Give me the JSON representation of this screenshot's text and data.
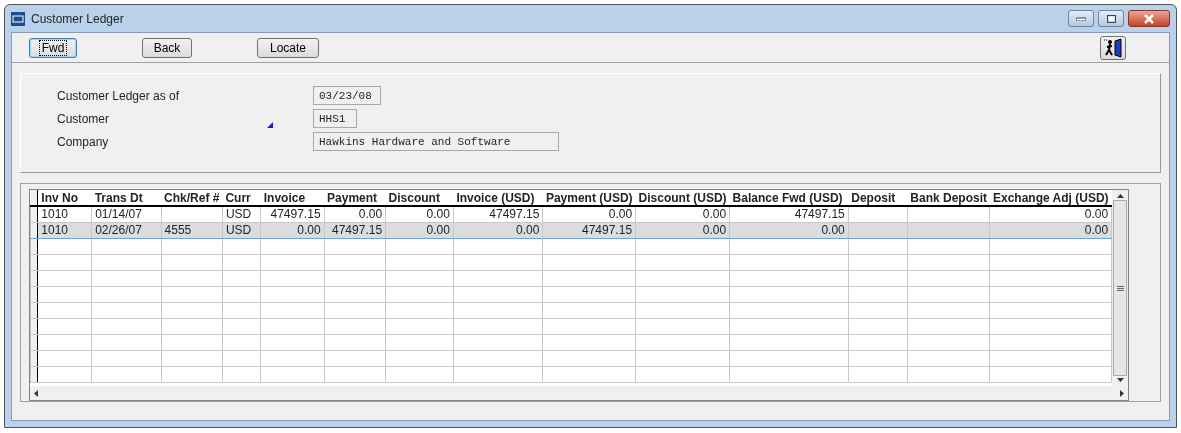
{
  "window": {
    "title": "Customer Ledger"
  },
  "toolbar": {
    "buttons": [
      {
        "label": "Fwd",
        "focused": true
      },
      {
        "label": "Back",
        "focused": false
      },
      {
        "label": "Locate",
        "focused": false
      }
    ]
  },
  "form": {
    "fields": [
      {
        "label": "Customer Ledger as of",
        "value": "03/23/08"
      },
      {
        "label": "Customer",
        "value": "HHS1",
        "lookup": true
      },
      {
        "label": "Company",
        "value": "Hawkins Hardware and Software"
      }
    ]
  },
  "table": {
    "columns": [
      "Inv No",
      "Trans Dt",
      "Chk/Ref #",
      "Curr",
      "Invoice",
      "Payment",
      "Discount",
      "Invoice (USD)",
      "Payment (USD)",
      "Discount (USD)",
      "Balance Fwd (USD)",
      "Deposit",
      "Bank Deposit",
      "Exchange Adj (USD)"
    ],
    "rows": [
      {
        "selected": false,
        "cells": [
          "1010",
          "01/14/07",
          null,
          "USD",
          "47497.15",
          "0.00",
          "0.00",
          "47497.15",
          "0.00",
          "0.00",
          "47497.15",
          null,
          null,
          "0.00"
        ]
      },
      {
        "selected": true,
        "cells": [
          "1010",
          "02/26/07",
          "4555",
          "USD",
          "0.00",
          "47497.15",
          "0.00",
          "0.00",
          "47497.15",
          "0.00",
          "0.00",
          null,
          null,
          "0.00"
        ]
      }
    ]
  }
}
